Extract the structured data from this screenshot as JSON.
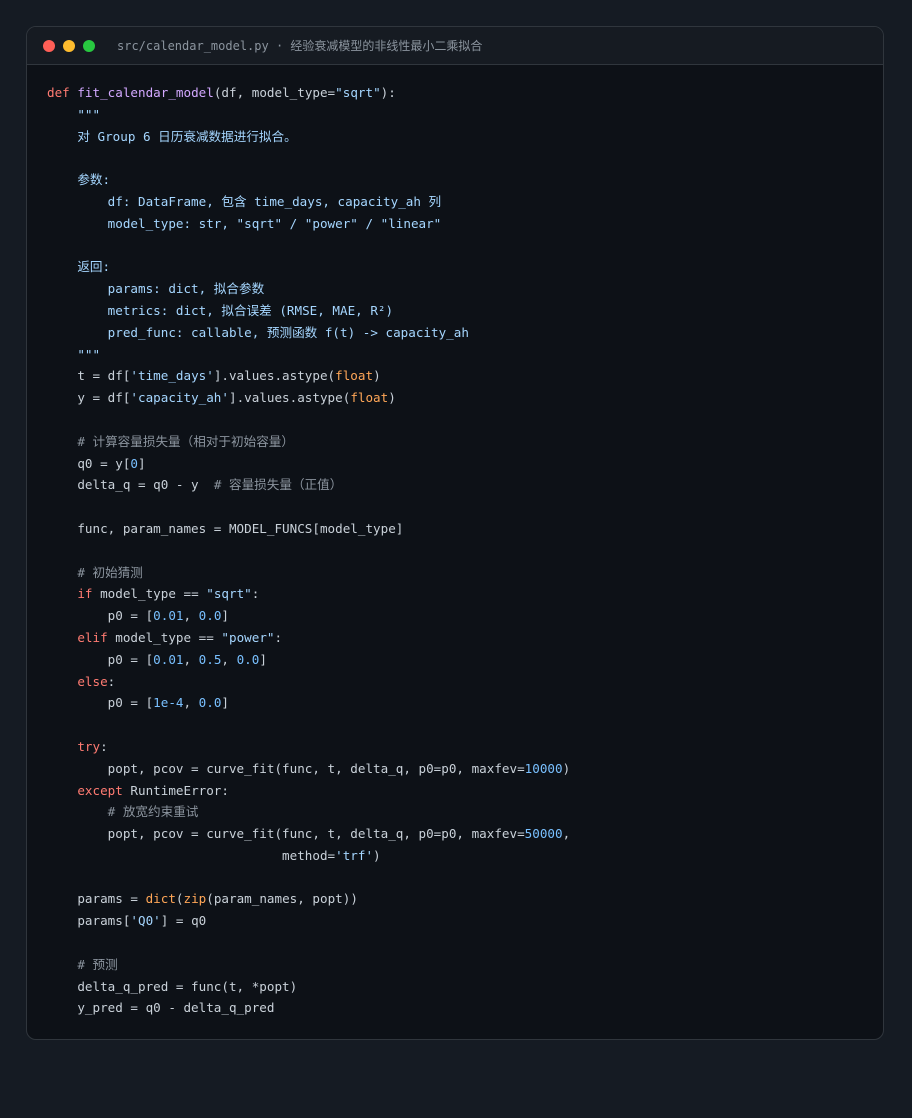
{
  "window": {
    "title": "src/calendar_model.py · 经验衰减模型的非线性最小二乘拟合"
  },
  "colors": {
    "background": "#151b23",
    "editor_bg": "#0d1117",
    "keyword": "#ff7b72",
    "function": "#d2a8ff",
    "string": "#a5d6ff",
    "number": "#79c0ff",
    "builtin": "#ffa657",
    "comment": "#8b949e",
    "text": "#c9d1d9"
  },
  "code_lines": [
    [
      [
        "kw",
        "def "
      ],
      [
        "fn",
        "fit_calendar_model"
      ],
      [
        "plain",
        "(df, model_type="
      ],
      [
        "str",
        "\"sqrt\""
      ],
      [
        "plain",
        "):"
      ]
    ],
    [
      [
        "doc",
        "    \"\"\""
      ]
    ],
    [
      [
        "doc",
        "    对 Group 6 日历衰减数据进行拟合。"
      ]
    ],
    [
      [
        "plain",
        ""
      ]
    ],
    [
      [
        "doc",
        "    参数:"
      ]
    ],
    [
      [
        "doc",
        "        df: DataFrame, 包含 time_days, capacity_ah 列"
      ]
    ],
    [
      [
        "doc",
        "        model_type: str, \"sqrt\" / \"power\" / \"linear\""
      ]
    ],
    [
      [
        "plain",
        ""
      ]
    ],
    [
      [
        "doc",
        "    返回:"
      ]
    ],
    [
      [
        "doc",
        "        params: dict, 拟合参数"
      ]
    ],
    [
      [
        "doc",
        "        metrics: dict, 拟合误差 (RMSE, MAE, R²)"
      ]
    ],
    [
      [
        "doc",
        "        pred_func: callable, 预测函数 f(t) -> capacity_ah"
      ]
    ],
    [
      [
        "doc",
        "    \"\"\""
      ]
    ],
    [
      [
        "plain",
        "    t = df["
      ],
      [
        "str",
        "'time_days'"
      ],
      [
        "plain",
        "].values.astype("
      ],
      [
        "bi",
        "float"
      ],
      [
        "plain",
        ")"
      ]
    ],
    [
      [
        "plain",
        "    y = df["
      ],
      [
        "str",
        "'capacity_ah'"
      ],
      [
        "plain",
        "].values.astype("
      ],
      [
        "bi",
        "float"
      ],
      [
        "plain",
        ")"
      ]
    ],
    [
      [
        "plain",
        ""
      ]
    ],
    [
      [
        "com",
        "    # 计算容量损失量（相对于初始容量）"
      ]
    ],
    [
      [
        "plain",
        "    q0 = y["
      ],
      [
        "num",
        "0"
      ],
      [
        "plain",
        "]"
      ]
    ],
    [
      [
        "plain",
        "    delta_q = q0 - y  "
      ],
      [
        "com",
        "# 容量损失量（正值）"
      ]
    ],
    [
      [
        "plain",
        ""
      ]
    ],
    [
      [
        "plain",
        "    func, param_names = MODEL_FUNCS[model_type]"
      ]
    ],
    [
      [
        "plain",
        ""
      ]
    ],
    [
      [
        "com",
        "    # 初始猜测"
      ]
    ],
    [
      [
        "kw",
        "    if "
      ],
      [
        "plain",
        "model_type == "
      ],
      [
        "str",
        "\"sqrt\""
      ],
      [
        "plain",
        ":"
      ]
    ],
    [
      [
        "plain",
        "        p0 = ["
      ],
      [
        "num",
        "0.01"
      ],
      [
        "plain",
        ", "
      ],
      [
        "num",
        "0.0"
      ],
      [
        "plain",
        "]"
      ]
    ],
    [
      [
        "kw",
        "    elif "
      ],
      [
        "plain",
        "model_type == "
      ],
      [
        "str",
        "\"power\""
      ],
      [
        "plain",
        ":"
      ]
    ],
    [
      [
        "plain",
        "        p0 = ["
      ],
      [
        "num",
        "0.01"
      ],
      [
        "plain",
        ", "
      ],
      [
        "num",
        "0.5"
      ],
      [
        "plain",
        ", "
      ],
      [
        "num",
        "0.0"
      ],
      [
        "plain",
        "]"
      ]
    ],
    [
      [
        "kw",
        "    else"
      ],
      [
        "plain",
        ":"
      ]
    ],
    [
      [
        "plain",
        "        p0 = ["
      ],
      [
        "num",
        "1e-4"
      ],
      [
        "plain",
        ", "
      ],
      [
        "num",
        "0.0"
      ],
      [
        "plain",
        "]"
      ]
    ],
    [
      [
        "plain",
        ""
      ]
    ],
    [
      [
        "kw",
        "    try"
      ],
      [
        "plain",
        ":"
      ]
    ],
    [
      [
        "plain",
        "        popt, pcov = curve_fit(func, t, delta_q, p0=p0, maxfev="
      ],
      [
        "num",
        "10000"
      ],
      [
        "plain",
        ")"
      ]
    ],
    [
      [
        "kw",
        "    except "
      ],
      [
        "plain",
        "RuntimeError:"
      ]
    ],
    [
      [
        "com",
        "        # 放宽约束重试"
      ]
    ],
    [
      [
        "plain",
        "        popt, pcov = curve_fit(func, t, delta_q, p0=p0, maxfev="
      ],
      [
        "num",
        "50000"
      ],
      [
        "plain",
        ","
      ]
    ],
    [
      [
        "plain",
        "                               method="
      ],
      [
        "str",
        "'trf'"
      ],
      [
        "plain",
        ")"
      ]
    ],
    [
      [
        "plain",
        ""
      ]
    ],
    [
      [
        "plain",
        "    params = "
      ],
      [
        "bi",
        "dict"
      ],
      [
        "plain",
        "("
      ],
      [
        "bi",
        "zip"
      ],
      [
        "plain",
        "(param_names, popt))"
      ]
    ],
    [
      [
        "plain",
        "    params["
      ],
      [
        "str",
        "'Q0'"
      ],
      [
        "plain",
        "] = q0"
      ]
    ],
    [
      [
        "plain",
        ""
      ]
    ],
    [
      [
        "com",
        "    # 预测"
      ]
    ],
    [
      [
        "plain",
        "    delta_q_pred = func(t, *popt)"
      ]
    ],
    [
      [
        "plain",
        "    y_pred = q0 - delta_q_pred"
      ]
    ]
  ]
}
